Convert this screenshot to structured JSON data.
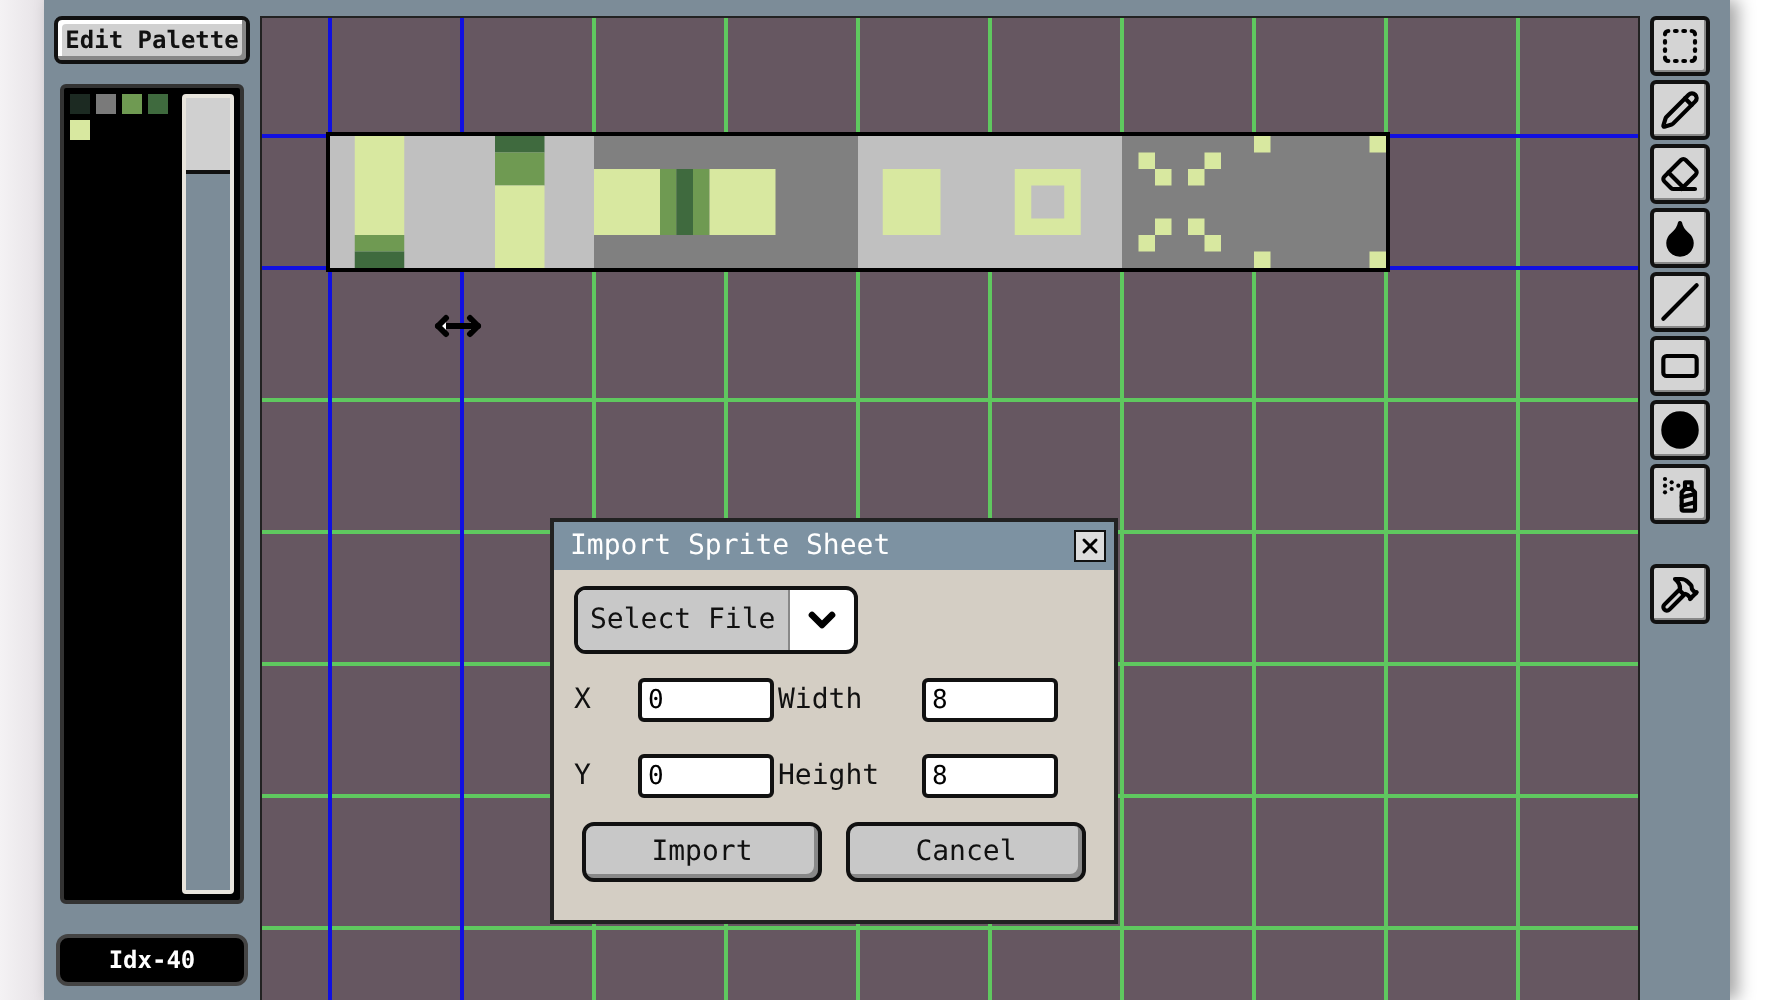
{
  "palette_panel": {
    "edit_button": "Edit Palette",
    "swatches": [
      {
        "color": "#1c2a22"
      },
      {
        "color": "#7a7a7a"
      },
      {
        "color": "#6f9a52"
      },
      {
        "color": "#3f6a3e"
      },
      {
        "color": "#d8e8a0"
      }
    ],
    "index_label": "Idx-40"
  },
  "tools": [
    {
      "kind": "select"
    },
    {
      "kind": "pencil"
    },
    {
      "kind": "eraser"
    },
    {
      "kind": "fill"
    },
    {
      "kind": "line"
    },
    {
      "kind": "rectangle"
    },
    {
      "kind": "blob"
    },
    {
      "kind": "spray"
    }
  ],
  "tools_extra": [
    {
      "kind": "settings"
    }
  ],
  "dialog": {
    "title": "Import Sprite Sheet",
    "file_select": "Select File",
    "fields": [
      {
        "label": "X",
        "value": "0"
      },
      {
        "label": "Width",
        "value": "8"
      },
      {
        "label": "Y",
        "value": "0"
      },
      {
        "label": "Height",
        "value": "8"
      }
    ],
    "buttons": [
      "Import",
      "Cancel"
    ]
  }
}
